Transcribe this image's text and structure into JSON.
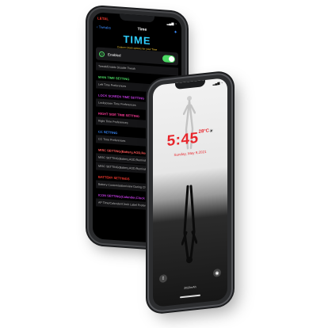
{
  "settings_phone": {
    "status_logo": "LETAL",
    "status_icons": "▂▄▆ ◔",
    "nav_back": "‹ Tweaks",
    "nav_title": "Time",
    "header_big": "TIME",
    "header_sub": "Custom Clock options for your Time",
    "enabled_label": "Enabled",
    "list": [
      {
        "kind": "row",
        "text": "Tweak/Enable Disable Tweak"
      },
      {
        "kind": "hdr",
        "text": "MAIN TIME SETTING",
        "color": "#4cd964"
      },
      {
        "kind": "row",
        "text": "Left Time Preferences"
      },
      {
        "kind": "hdr",
        "text": "LOCK SCREEN TIME SETTING",
        "color": "#c23be0"
      },
      {
        "kind": "row",
        "text": "Lockscreen Time Preferences"
      },
      {
        "kind": "hdr",
        "text": "RIGHT SIDE TIME SETTING",
        "color": "#ff3b9a"
      },
      {
        "kind": "row",
        "text": "Right Time Preferences"
      },
      {
        "kind": "hdr",
        "text": "CC SETTING",
        "color": "#3b8cff"
      },
      {
        "kind": "row",
        "text": "CC Time Preferences"
      },
      {
        "kind": "hdr",
        "text": "MISC SETTING(Battery,AOD,Reminder)",
        "color": "#ff5a5a"
      },
      {
        "kind": "row",
        "text": "MISC SETTING(Battery,AOD,Reminder) Preferences"
      },
      {
        "kind": "row",
        "text": "MISC SETTING(Battery,AOD,Reminder) (Preferences)"
      },
      {
        "kind": "hdr",
        "text": "BATTERY SETTINGS",
        "color": "#ff3b30"
      },
      {
        "kind": "row",
        "text": "Battery Customization/view During Charging"
      },
      {
        "kind": "hdr",
        "text": "ICON SETTING(Calender,Clock Label)",
        "color": "#c23be0"
      },
      {
        "kind": "row",
        "text": "AP Time/Calender/Clock Label Preferences"
      }
    ]
  },
  "lock_phone": {
    "status_left": "",
    "status_right": "▂▄▆ ◔",
    "clock": "5:45",
    "temp": "28°C",
    "weather_icon": "☀",
    "date": "Sunday, May 9,2021",
    "battery_text": "2022mAh",
    "torch_icon": "flashlight-icon",
    "camera_icon": "camera-icon"
  }
}
